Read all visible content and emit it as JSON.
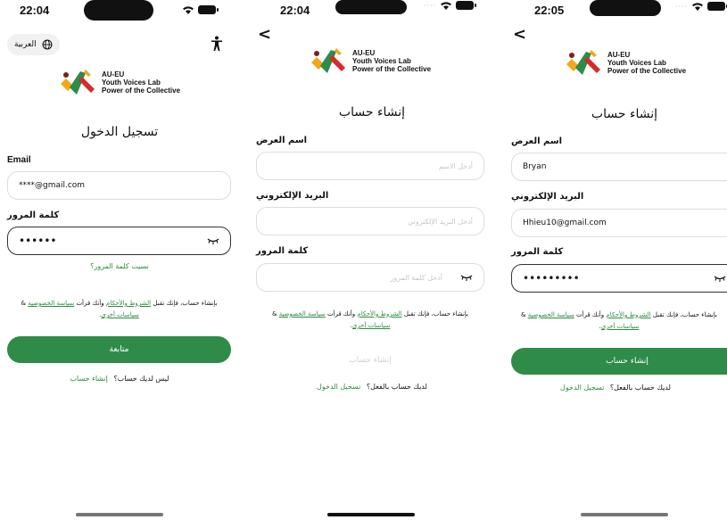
{
  "screens": [
    {
      "time": "22:04",
      "language_label": "العربية",
      "logo": {
        "line1": "AU-EU",
        "line2": "Youth Voices Lab",
        "line3": "Power of the Collective"
      },
      "title": "تسجيل الدخول",
      "email_label": "Email",
      "email_value": "****@gmail.com",
      "password_label": "كلمة المرور",
      "password_value": "••••••",
      "forgot_label": "نسيت كلمة المرور؟",
      "terms": {
        "prefix": "&",
        "privacy": "سياسة الخصوصية",
        "mid": "وأنك قرأت",
        "conditions": "الشروط والأحكام",
        "text": "بإنشاء حساب، فإنك تقبل",
        "other": "سياسات أخرى",
        "end": "."
      },
      "submit_label": "متابعة",
      "bottom_question": "ليس لديك حساب؟",
      "bottom_link": "إنشاء حساب"
    },
    {
      "time": "22:04",
      "back_label": "<",
      "logo": {
        "line1": "AU-EU",
        "line2": "Youth Voices Lab",
        "line3": "Power of the Collective"
      },
      "title": "إنشاء حساب",
      "name_label": "اسم العرض",
      "name_placeholder": "أدخل الاسم",
      "email_label": "البريد الإلكتروني",
      "email_placeholder": "أدخل البريد الإلكتروني",
      "password_label": "كلمة المرور",
      "password_placeholder": "أدخل كلمة المرور",
      "terms": {
        "prefix": "&",
        "privacy": "سياسة الخصوصية",
        "mid": "وأنك قرأت",
        "conditions": "الشروط والأحكام",
        "text": "بإنشاء حساب، فإنك تقبل",
        "other": "سياسات أخرى",
        "end": "."
      },
      "submit_label": "إنشاء حساب",
      "bottom_question": "لديك حساب بالفعل؟",
      "bottom_link": "تسجيل الدخول"
    },
    {
      "time": "22:05",
      "back_label": "<",
      "logo": {
        "line1": "AU-EU",
        "line2": "Youth Voices Lab",
        "line3": "Power of the Collective"
      },
      "title": "إنشاء حساب",
      "name_label": "اسم العرض",
      "name_value": "Bryan",
      "email_label": "البريد الإلكتروني",
      "email_value": "Hhieu10@gmail.com",
      "password_label": "كلمة المرور",
      "password_value": "•••••••••",
      "terms": {
        "prefix": "&",
        "privacy": "سياسة الخصوصية",
        "mid": "وأنك قرأت",
        "conditions": "الشروط والأحكام",
        "text": "بإنشاء حساب، فإنك تقبل",
        "other": "سياسات أخرى",
        "end": "."
      },
      "submit_label": "إنشاء حساب",
      "bottom_question": "لديك حساب بالفعل؟",
      "bottom_link": "تسجيل الدخول"
    }
  ],
  "colors": {
    "accent": "#2e8b4a",
    "link": "#2e8b3e"
  },
  "icons": [
    "globe-icon",
    "accessibility-icon",
    "eye-closed-icon",
    "wifi-icon",
    "battery-icon",
    "back-chevron-icon"
  ]
}
